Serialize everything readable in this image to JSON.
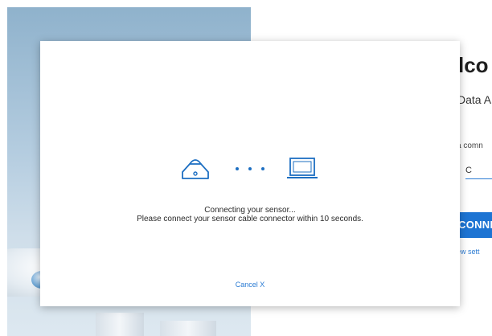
{
  "welcome": {
    "title": "lco",
    "subtitle": "Data A",
    "prompt": "a comn",
    "field_value": "C",
    "connect_label": "CONNE",
    "settings_link": "ew sett"
  },
  "modal": {
    "status_line1": "Connecting your sensor...",
    "status_line2": "Please connect your sensor cable connector within 10 seconds.",
    "cancel_label": "Cancel X",
    "icons": [
      "sensor-icon",
      "dots-icon",
      "laptop-icon"
    ]
  },
  "colors": {
    "accent": "#1d74d3",
    "link": "#2b7bd3",
    "icon": "#1d6fc2"
  }
}
